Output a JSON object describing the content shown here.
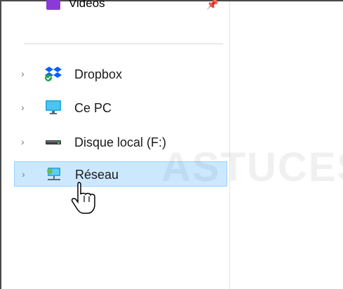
{
  "pinned": {
    "label": "Vidéos",
    "icon": "videos-folder-icon"
  },
  "tree": [
    {
      "label": "Dropbox",
      "icon": "dropbox-icon",
      "selected": false
    },
    {
      "label": "Ce PC",
      "icon": "computer-icon",
      "selected": false
    },
    {
      "label": "Disque local (F:)",
      "icon": "drive-icon",
      "selected": false
    },
    {
      "label": "Réseau",
      "icon": "network-icon",
      "selected": true
    }
  ],
  "watermark": "ASTUCES",
  "colors": {
    "selection": "#cce8ff",
    "selection_border": "#99d1ff"
  }
}
